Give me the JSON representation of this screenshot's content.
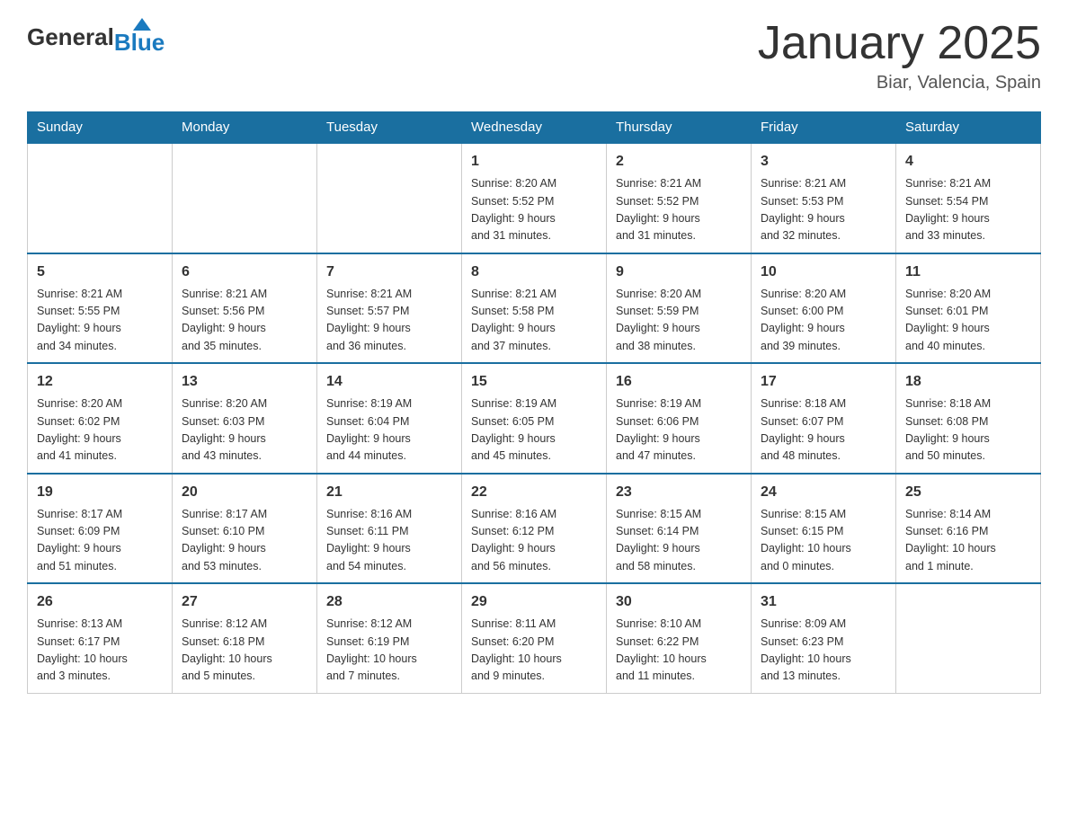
{
  "header": {
    "logo_general": "General",
    "logo_blue": "Blue",
    "month_title": "January 2025",
    "location": "Biar, Valencia, Spain"
  },
  "weekdays": [
    "Sunday",
    "Monday",
    "Tuesday",
    "Wednesday",
    "Thursday",
    "Friday",
    "Saturday"
  ],
  "weeks": [
    [
      {
        "day": "",
        "info": ""
      },
      {
        "day": "",
        "info": ""
      },
      {
        "day": "",
        "info": ""
      },
      {
        "day": "1",
        "info": "Sunrise: 8:20 AM\nSunset: 5:52 PM\nDaylight: 9 hours\nand 31 minutes."
      },
      {
        "day": "2",
        "info": "Sunrise: 8:21 AM\nSunset: 5:52 PM\nDaylight: 9 hours\nand 31 minutes."
      },
      {
        "day": "3",
        "info": "Sunrise: 8:21 AM\nSunset: 5:53 PM\nDaylight: 9 hours\nand 32 minutes."
      },
      {
        "day": "4",
        "info": "Sunrise: 8:21 AM\nSunset: 5:54 PM\nDaylight: 9 hours\nand 33 minutes."
      }
    ],
    [
      {
        "day": "5",
        "info": "Sunrise: 8:21 AM\nSunset: 5:55 PM\nDaylight: 9 hours\nand 34 minutes."
      },
      {
        "day": "6",
        "info": "Sunrise: 8:21 AM\nSunset: 5:56 PM\nDaylight: 9 hours\nand 35 minutes."
      },
      {
        "day": "7",
        "info": "Sunrise: 8:21 AM\nSunset: 5:57 PM\nDaylight: 9 hours\nand 36 minutes."
      },
      {
        "day": "8",
        "info": "Sunrise: 8:21 AM\nSunset: 5:58 PM\nDaylight: 9 hours\nand 37 minutes."
      },
      {
        "day": "9",
        "info": "Sunrise: 8:20 AM\nSunset: 5:59 PM\nDaylight: 9 hours\nand 38 minutes."
      },
      {
        "day": "10",
        "info": "Sunrise: 8:20 AM\nSunset: 6:00 PM\nDaylight: 9 hours\nand 39 minutes."
      },
      {
        "day": "11",
        "info": "Sunrise: 8:20 AM\nSunset: 6:01 PM\nDaylight: 9 hours\nand 40 minutes."
      }
    ],
    [
      {
        "day": "12",
        "info": "Sunrise: 8:20 AM\nSunset: 6:02 PM\nDaylight: 9 hours\nand 41 minutes."
      },
      {
        "day": "13",
        "info": "Sunrise: 8:20 AM\nSunset: 6:03 PM\nDaylight: 9 hours\nand 43 minutes."
      },
      {
        "day": "14",
        "info": "Sunrise: 8:19 AM\nSunset: 6:04 PM\nDaylight: 9 hours\nand 44 minutes."
      },
      {
        "day": "15",
        "info": "Sunrise: 8:19 AM\nSunset: 6:05 PM\nDaylight: 9 hours\nand 45 minutes."
      },
      {
        "day": "16",
        "info": "Sunrise: 8:19 AM\nSunset: 6:06 PM\nDaylight: 9 hours\nand 47 minutes."
      },
      {
        "day": "17",
        "info": "Sunrise: 8:18 AM\nSunset: 6:07 PM\nDaylight: 9 hours\nand 48 minutes."
      },
      {
        "day": "18",
        "info": "Sunrise: 8:18 AM\nSunset: 6:08 PM\nDaylight: 9 hours\nand 50 minutes."
      }
    ],
    [
      {
        "day": "19",
        "info": "Sunrise: 8:17 AM\nSunset: 6:09 PM\nDaylight: 9 hours\nand 51 minutes."
      },
      {
        "day": "20",
        "info": "Sunrise: 8:17 AM\nSunset: 6:10 PM\nDaylight: 9 hours\nand 53 minutes."
      },
      {
        "day": "21",
        "info": "Sunrise: 8:16 AM\nSunset: 6:11 PM\nDaylight: 9 hours\nand 54 minutes."
      },
      {
        "day": "22",
        "info": "Sunrise: 8:16 AM\nSunset: 6:12 PM\nDaylight: 9 hours\nand 56 minutes."
      },
      {
        "day": "23",
        "info": "Sunrise: 8:15 AM\nSunset: 6:14 PM\nDaylight: 9 hours\nand 58 minutes."
      },
      {
        "day": "24",
        "info": "Sunrise: 8:15 AM\nSunset: 6:15 PM\nDaylight: 10 hours\nand 0 minutes."
      },
      {
        "day": "25",
        "info": "Sunrise: 8:14 AM\nSunset: 6:16 PM\nDaylight: 10 hours\nand 1 minute."
      }
    ],
    [
      {
        "day": "26",
        "info": "Sunrise: 8:13 AM\nSunset: 6:17 PM\nDaylight: 10 hours\nand 3 minutes."
      },
      {
        "day": "27",
        "info": "Sunrise: 8:12 AM\nSunset: 6:18 PM\nDaylight: 10 hours\nand 5 minutes."
      },
      {
        "day": "28",
        "info": "Sunrise: 8:12 AM\nSunset: 6:19 PM\nDaylight: 10 hours\nand 7 minutes."
      },
      {
        "day": "29",
        "info": "Sunrise: 8:11 AM\nSunset: 6:20 PM\nDaylight: 10 hours\nand 9 minutes."
      },
      {
        "day": "30",
        "info": "Sunrise: 8:10 AM\nSunset: 6:22 PM\nDaylight: 10 hours\nand 11 minutes."
      },
      {
        "day": "31",
        "info": "Sunrise: 8:09 AM\nSunset: 6:23 PM\nDaylight: 10 hours\nand 13 minutes."
      },
      {
        "day": "",
        "info": ""
      }
    ]
  ]
}
